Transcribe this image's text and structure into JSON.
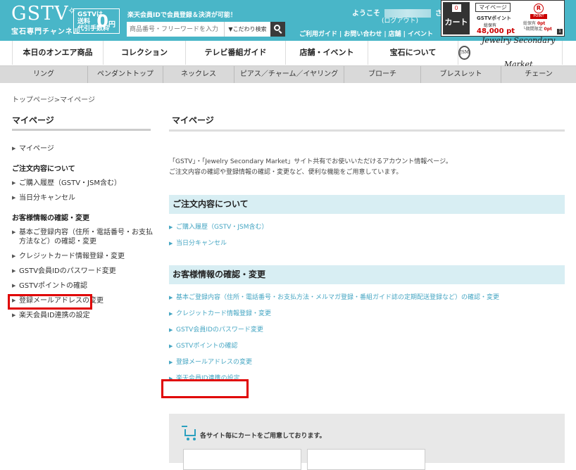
{
  "header": {
    "logo": "GSTV",
    "logo_sub": "宝石専門チャンネル",
    "promo_line1": "GSTVは",
    "promo_line2": "送料",
    "promo_line3": "代引手数料",
    "promo_value": "0",
    "promo_unit": "円",
    "rakuten_message": "楽天会員IDで会員登録＆決済が可能！",
    "search_placeholder": "商品番号・フリーワードを入力",
    "kodawari_label": "▼こだわり検索",
    "welcome": "ようこそ",
    "welcome_suffix": "さん",
    "logout": "(ログアウト)",
    "links": [
      "ご利用ガイド",
      "お問い合わせ",
      "店舗",
      "イベント"
    ],
    "cart_count": "0",
    "cart_label": "カート",
    "mypage_label": "マイページ",
    "points_label": "GSTVポイント",
    "points_sub": "総保有",
    "points_value": "48,000 pt",
    "rakuten_logo": "R",
    "rakuten_point_label": "POINT",
    "rakuten_rows": [
      {
        "label": "総保有",
        "value": "0pt"
      },
      {
        "label": "└期間限定",
        "value": "0pt"
      }
    ],
    "cart_corner": "1"
  },
  "main_nav": [
    "本日のオンエア商品",
    "コレクション",
    "テレビ番組ガイド",
    "店舗・イベント",
    "宝石について"
  ],
  "jsm_label": "Jewelry Secondary Market",
  "jsm_ring": "JSM",
  "sub_nav": [
    "リング",
    "ペンダントトップ",
    "ネックレス",
    "ピアス／チャーム／イヤリング",
    "ブローチ",
    "ブレスレット",
    "チェーン"
  ],
  "breadcrumb": "トップページ>マイページ",
  "sidebar": {
    "title": "マイページ",
    "mypage_link": "マイページ",
    "order_head": "ご注文内容について",
    "order_links": [
      "ご購入履歴（GSTV・JSM含む）",
      "当日分キャンセル"
    ],
    "info_head": "お客様情報の確認・変更",
    "info_links": [
      "基本ご登録内容（住所・電話番号・お支払方法など）の確認・変更",
      "クレジットカード情報登録・変更",
      "GSTV会員IDのパスワード変更",
      "GSTVポイントの確認",
      "登録メールアドレスの変更",
      "楽天会員ID連携の設定"
    ]
  },
  "main": {
    "title": "マイページ",
    "intro_line1": "「GSTV」・「Jewelry Secondary Market」サイト共有でお使いいただけるアカウント情報ページ。",
    "intro_line2": "ご注文内容の確認や登録情報の確認・変更など、便利な機能をご用意しています。",
    "order_section": "ご注文内容について",
    "order_links": [
      "ご購入履歴（GSTV・JSM含む）",
      "当日分キャンセル"
    ],
    "info_section": "お客様情報の確認・変更",
    "info_links": [
      "基本ご登録内容（住所・電話番号・お支払方法・メルマガ登録・番組ガイド誌の定期配送登録など）の確認・変更",
      "クレジットカード情報登録・変更",
      "GSTV会員IDのパスワード変更",
      "GSTVポイントの確認",
      "登録メールアドレスの変更",
      "楽天会員ID連携の設定"
    ],
    "cart_info": "各サイト毎にカートをご用意しております。"
  },
  "colors": {
    "header_bg": "#49b6c8",
    "section_bg": "#d8eef3",
    "link": "#46a6c3",
    "highlight": "#e00000"
  }
}
